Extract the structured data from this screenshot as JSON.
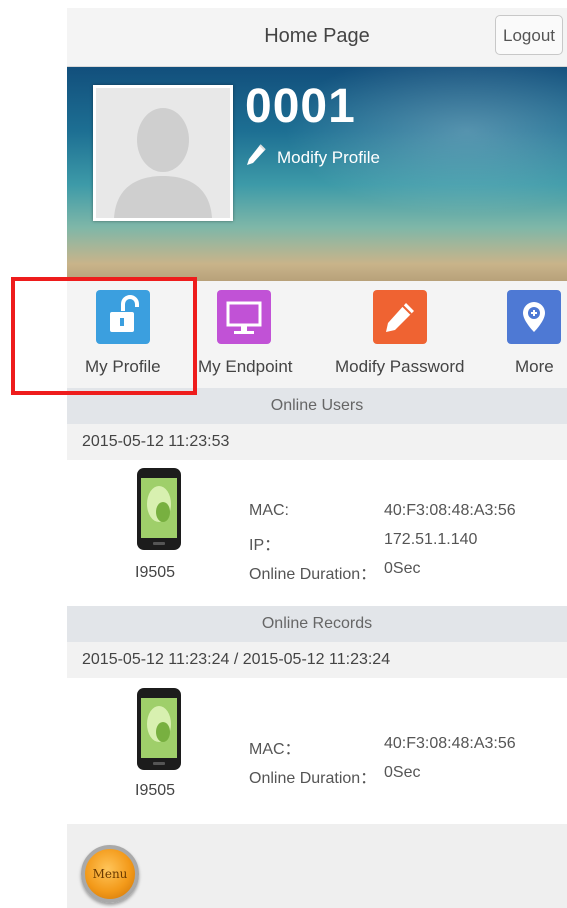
{
  "header": {
    "title": "Home Page",
    "logout_label": "Logout"
  },
  "profile": {
    "user_id": "0001",
    "modify_label": "Modify Profile"
  },
  "quick_actions": [
    {
      "label": "My Profile",
      "icon": "unlock-icon",
      "color": "#3b9fdf"
    },
    {
      "label": "My Endpoint",
      "icon": "monitor-icon",
      "color": "#c152d6"
    },
    {
      "label": "Modify Password",
      "icon": "pencil-icon",
      "color": "#ef6332"
    },
    {
      "label": "More",
      "icon": "location-pin-icon",
      "color": "#4e79d4"
    }
  ],
  "online_users": {
    "section_title": "Online Users",
    "timestamp": "2015-05-12 11:23:53",
    "device": {
      "model": "I9505",
      "mac_label": "MAC:",
      "mac_value": "40:F3:08:48:A3:56",
      "ip_label": "IP：",
      "ip_value": "172.51.1.140",
      "duration_label": "Online Duration：",
      "duration_value": "0Sec"
    }
  },
  "online_records": {
    "section_title": "Online Records",
    "timestamp": "2015-05-12 11:23:24 / 2015-05-12 11:23:24",
    "device": {
      "model": "I9505",
      "mac_label": "MAC：",
      "mac_value": "40:F3:08:48:A3:56",
      "duration_label": "Online Duration：",
      "duration_value": "0Sec"
    }
  },
  "footer": {
    "menu_label": "Menu"
  },
  "highlight_color": "#ee1c1c"
}
